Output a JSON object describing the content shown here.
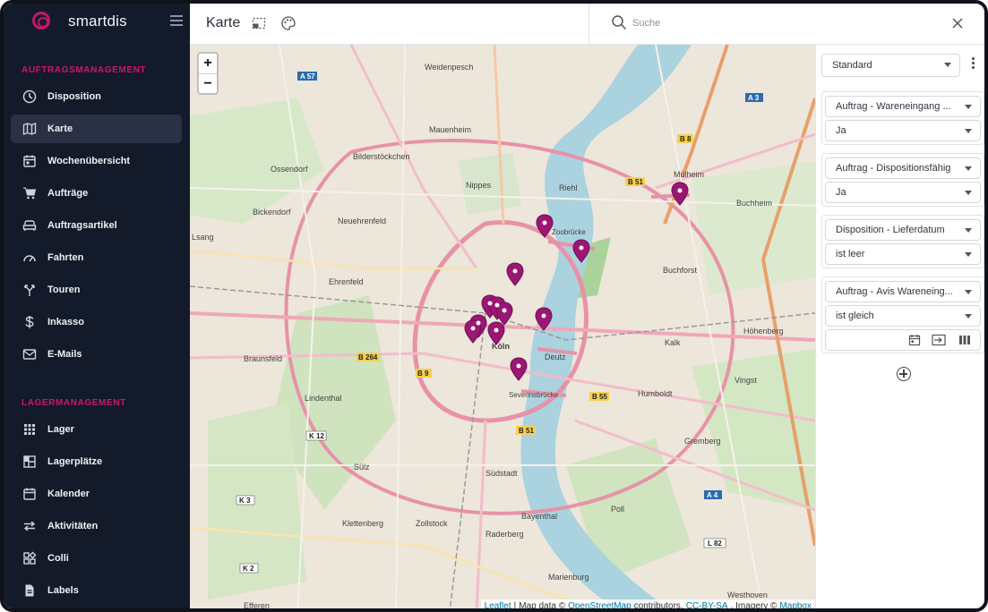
{
  "app": {
    "name": "smartdis"
  },
  "sidebar": {
    "sections": [
      {
        "title": "AUFTRAGSMANAGEMENT"
      },
      {
        "title": "LAGERMANAGEMENT"
      }
    ],
    "items": [
      {
        "label": "Disposition",
        "icon": "clock-icon"
      },
      {
        "label": "Karte",
        "icon": "map-icon",
        "active": true
      },
      {
        "label": "Wochenübersicht",
        "icon": "calendar-week-icon"
      },
      {
        "label": "Aufträge",
        "icon": "cart-icon"
      },
      {
        "label": "Auftragsartikel",
        "icon": "sofa-icon"
      },
      {
        "label": "Fahrten",
        "icon": "speedometer-icon"
      },
      {
        "label": "Touren",
        "icon": "route-icon"
      },
      {
        "label": "Inkasso",
        "icon": "dollar-icon"
      },
      {
        "label": "E-Mails",
        "icon": "mail-icon"
      },
      {
        "label": "Lager",
        "icon": "grid-icon"
      },
      {
        "label": "Lagerplätze",
        "icon": "layout-icon"
      },
      {
        "label": "Kalender",
        "icon": "calendar-icon"
      },
      {
        "label": "Aktivitäten",
        "icon": "swap-icon"
      },
      {
        "label": "Colli",
        "icon": "boxes-icon"
      },
      {
        "label": "Labels",
        "icon": "document-icon"
      }
    ]
  },
  "header": {
    "title": "Karte",
    "search_placeholder": "Suche"
  },
  "map": {
    "zoom_in": "+",
    "zoom_out": "−",
    "attribution": {
      "leaflet": "Leaflet",
      "sep": "|",
      "text1": "Map data ©",
      "osm": "OpenStreetMap",
      "text2": "contributors,",
      "license": "CC-BY-SA",
      "text3": ", Imagery ©",
      "mapbox": "Mapbox"
    },
    "labels": [
      "Weidenpesch",
      "Mauenheim",
      "Bilderstöckchen",
      "Nippes",
      "Riehl",
      "Ossendorf",
      "Bickendorf",
      "Neuehrenfeld",
      "Ehrenfeld",
      "Braunsfeld",
      "Lindenthal",
      "Sülz",
      "Klettenberg",
      "Zollstock",
      "Südstadt",
      "Bayenthal",
      "Raderberg",
      "Marienburg",
      "Efferen",
      "Köln",
      "Deutz",
      "Humboldt",
      "Kalk",
      "Vingst",
      "Buchforst",
      "Mülheim",
      "Buchheim",
      "Höhenberg",
      "Gremberg",
      "Poll",
      "Westhoven",
      "Severinsbrücke",
      "Zoobrücke",
      "Lsang"
    ],
    "road_labels": [
      "A 57",
      "B 8",
      "B 51",
      "A 3",
      "B 264",
      "B 9",
      "K 12",
      "B 55",
      "B 51",
      "K 3",
      "A 4",
      "L 82",
      "K 2"
    ],
    "marker_color": "#9c1674"
  },
  "filters": {
    "view_select": "Standard",
    "groups": [
      {
        "field_prefix": "Auftrag -",
        "field": "Wareneingang ...",
        "value": "Ja"
      },
      {
        "field_prefix": "Auftrag -",
        "field": "Dispositionsfähig",
        "value": "Ja"
      },
      {
        "field_prefix": "Disposition -",
        "field": "Lieferdatum",
        "value": "ist leer"
      },
      {
        "field_prefix": "Auftrag -",
        "field": "Avis Wareneing...",
        "value": "ist gleich"
      }
    ]
  },
  "colors": {
    "sidebar_bg": "#131a2a",
    "accent": "#d0156f",
    "active_item": "#2a3144"
  }
}
